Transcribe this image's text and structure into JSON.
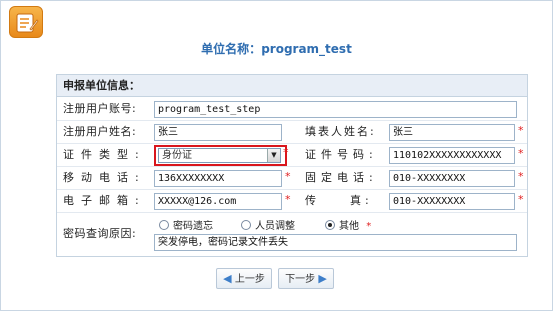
{
  "header": {
    "unit_label": "单位名称：",
    "unit_value": "program_test"
  },
  "section": {
    "title": "申报单位信息："
  },
  "form": {
    "username_label": "注册用户账号:",
    "username_value": "program_test_step",
    "name_label": "注册用户姓名:",
    "name_value": "张三",
    "filler_label": "填表人姓名:",
    "filler_value": "张三",
    "id_type_label": "证件类型:",
    "id_type_value": "身份证",
    "id_no_label": "证件号码:",
    "id_no_value": "110102XXXXXXXXXXXX",
    "mobile_label": "移动电话:",
    "mobile_value": "136XXXXXXXX",
    "phone_label": "固定电话:",
    "phone_value": "010-XXXXXXXX",
    "email_label": "电子邮箱:",
    "email_value": "XXXXX@126.com",
    "fax_label": "传　　真:",
    "fax_value": "010-XXXXXXXX",
    "reason_label": "密码查询原因:",
    "reason_options": [
      "密码遗忘",
      "人员调整",
      "其他"
    ],
    "reason_selected": "其他",
    "reason_text": "突发停电，密码记录文件丢失",
    "required_mark": "*"
  },
  "buttons": {
    "prev_label": "上一步",
    "next_label": "下一步"
  },
  "colors": {
    "title_blue": "#2f6db0",
    "required_red": "#e02020",
    "highlight_red": "#d9161d",
    "section_bg": "#e8eef6"
  }
}
